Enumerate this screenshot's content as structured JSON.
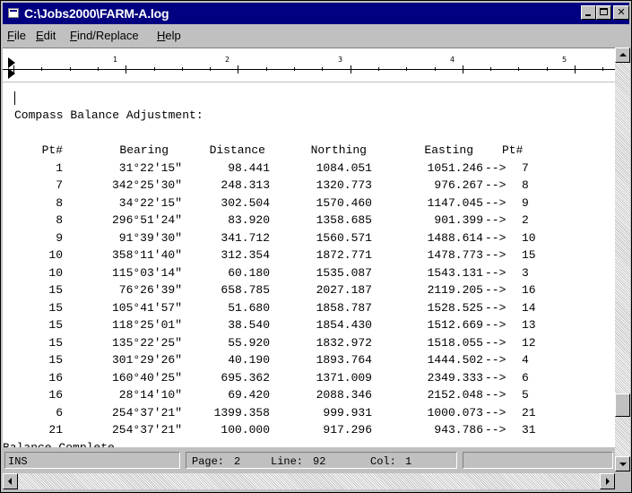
{
  "window": {
    "title": "C:\\Jobs2000\\FARM-A.log"
  },
  "menu": [
    {
      "label": "File",
      "mnemonic": "F",
      "rest": "ile"
    },
    {
      "label": "Edit",
      "mnemonic": "E",
      "rest": "dit"
    },
    {
      "label": "Find/Replace",
      "mnemonic": "F",
      "rest": "ind/Replace"
    },
    {
      "label": "Help",
      "mnemonic": "H",
      "rest": "elp"
    }
  ],
  "ruler": {
    "numbers": [
      "1",
      "2",
      "3",
      "4",
      "5"
    ]
  },
  "document": {
    "heading": "Compass Balance Adjustment:",
    "headers": {
      "pt": "Pt#",
      "bearing": "Bearing",
      "distance": "Distance",
      "northing": "Northing",
      "easting": "Easting",
      "to_pt": "Pt#"
    },
    "rows": [
      {
        "pt": "1",
        "bearing": "31°22'15\"",
        "distance": "98.441",
        "northing": "1084.051",
        "easting": "1051.246",
        "arrow": "-->",
        "to": "7"
      },
      {
        "pt": "7",
        "bearing": "342°25'30\"",
        "distance": "248.313",
        "northing": "1320.773",
        "easting": "976.267",
        "arrow": "-->",
        "to": "8"
      },
      {
        "pt": "8",
        "bearing": "34°22'15\"",
        "distance": "302.504",
        "northing": "1570.460",
        "easting": "1147.045",
        "arrow": "-->",
        "to": "9"
      },
      {
        "pt": "8",
        "bearing": "296°51'24\"",
        "distance": "83.920",
        "northing": "1358.685",
        "easting": "901.399",
        "arrow": "-->",
        "to": "2"
      },
      {
        "pt": "9",
        "bearing": "91°39'30\"",
        "distance": "341.712",
        "northing": "1560.571",
        "easting": "1488.614",
        "arrow": "-->",
        "to": "10"
      },
      {
        "pt": "10",
        "bearing": "358°11'40\"",
        "distance": "312.354",
        "northing": "1872.771",
        "easting": "1478.773",
        "arrow": "-->",
        "to": "15"
      },
      {
        "pt": "10",
        "bearing": "115°03'14\"",
        "distance": "60.180",
        "northing": "1535.087",
        "easting": "1543.131",
        "arrow": "-->",
        "to": "3"
      },
      {
        "pt": "15",
        "bearing": "76°26'39\"",
        "distance": "658.785",
        "northing": "2027.187",
        "easting": "2119.205",
        "arrow": "-->",
        "to": "16"
      },
      {
        "pt": "15",
        "bearing": "105°41'57\"",
        "distance": "51.680",
        "northing": "1858.787",
        "easting": "1528.525",
        "arrow": "-->",
        "to": "14"
      },
      {
        "pt": "15",
        "bearing": "118°25'01\"",
        "distance": "38.540",
        "northing": "1854.430",
        "easting": "1512.669",
        "arrow": "-->",
        "to": "13"
      },
      {
        "pt": "15",
        "bearing": "135°22'25\"",
        "distance": "55.920",
        "northing": "1832.972",
        "easting": "1518.055",
        "arrow": "-->",
        "to": "12"
      },
      {
        "pt": "15",
        "bearing": "301°29'26\"",
        "distance": "40.190",
        "northing": "1893.764",
        "easting": "1444.502",
        "arrow": "-->",
        "to": "4"
      },
      {
        "pt": "16",
        "bearing": "160°40'25\"",
        "distance": "695.362",
        "northing": "1371.009",
        "easting": "2349.333",
        "arrow": "-->",
        "to": "6"
      },
      {
        "pt": "16",
        "bearing": "28°14'10\"",
        "distance": "69.420",
        "northing": "2088.346",
        "easting": "2152.048",
        "arrow": "-->",
        "to": "5"
      },
      {
        "pt": "6",
        "bearing": "254°37'21\"",
        "distance": "1399.358",
        "northing": "999.931",
        "easting": "1000.073",
        "arrow": "-->",
        "to": "21"
      },
      {
        "pt": "21",
        "bearing": "254°37'21\"",
        "distance": "100.000",
        "northing": "917.296",
        "easting": "943.786",
        "arrow": "-->",
        "to": "31"
      }
    ],
    "footer": "Balance Complete."
  },
  "status": {
    "mode": "INS",
    "page_label": "Page:",
    "page": "2",
    "line_label": "Line:",
    "line": "92",
    "col_label": "Col:",
    "col": "1"
  },
  "colors": {
    "titlebar": "#000080",
    "face": "#c0c0c0",
    "editor_bg": "#ffffff"
  }
}
